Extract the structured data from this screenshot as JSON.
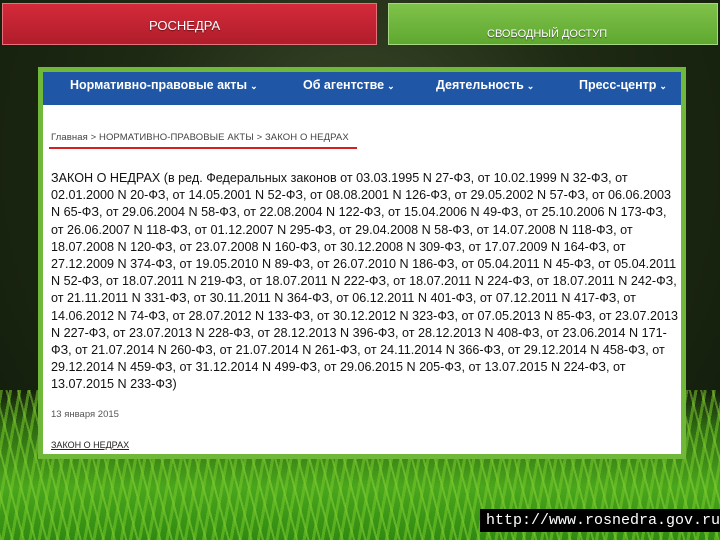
{
  "tabs": {
    "left_label": "РОСНЕДРА",
    "right_label": "СВОБОДНЫЙ ДОСТУП"
  },
  "nav": {
    "items": [
      {
        "label": "Нормативно-правовые акты"
      },
      {
        "label": "Об агентстве"
      },
      {
        "label": "Деятельность"
      },
      {
        "label": "Пресс-центр"
      }
    ],
    "chevron": "⌄"
  },
  "breadcrumb": {
    "text": "Главная > НОРМАТИВНО-ПРАВОВЫЕ АКТЫ > ЗАКОН О НЕДРАХ"
  },
  "law_text": "ЗАКОН О НЕДРАХ (в ред. Федеральных законов от 03.03.1995 N 27-ФЗ, от 10.02.1999 N 32-ФЗ, от 02.01.2000 N 20-ФЗ, от 14.05.2001 N 52-ФЗ, от 08.08.2001 N 126-ФЗ, от 29.05.2002 N 57-ФЗ, от 06.06.2003 N 65-ФЗ, от 29.06.2004 N 58-ФЗ, от 22.08.2004 N 122-ФЗ, от 15.04.2006 N 49-ФЗ, от 25.10.2006 N 173-ФЗ, от 26.06.2007 N 118-ФЗ, от 01.12.2007 N 295-ФЗ, от 29.04.2008 N 58-ФЗ, от 14.07.2008 N 118-ФЗ, от 18.07.2008 N 120-ФЗ, от 23.07.2008 N 160-ФЗ, от 30.12.2008 N 309-ФЗ, от 17.07.2009 N 164-ФЗ, от 27.12.2009 N 374-ФЗ, от 19.05.2010 N 89-ФЗ, от 26.07.2010 N 186-ФЗ, от 05.04.2011 N 45-ФЗ, от 05.04.2011 N 52-ФЗ, от 18.07.2011 N 219-ФЗ, от 18.07.2011 N 222-ФЗ, от 18.07.2011 N 224-ФЗ, от 18.07.2011 N 242-ФЗ, от 21.11.2011 N 331-ФЗ, от 30.11.2011 N 364-ФЗ, от 06.12.2011 N 401-ФЗ, от 07.12.2011 N 417-ФЗ, от 14.06.2012 N 74-ФЗ, от 28.07.2012 N 133-ФЗ, от 30.12.2012 N 323-ФЗ, от 07.05.2013 N 85-ФЗ, от 23.07.2013 N 227-ФЗ, от 23.07.2013 N 228-ФЗ, от 28.12.2013 N 396-ФЗ, от 28.12.2013 N 408-ФЗ, от 23.06.2014 N 171-ФЗ, от 21.07.2014 N 260-ФЗ, от 21.07.2014 N 261-ФЗ, от 24.11.2014 N 366-ФЗ, от 29.12.2014 N 458-ФЗ, от 29.12.2014 N 459-ФЗ, от 31.12.2014 N 499-ФЗ, от 29.06.2015 N 205-ФЗ, от 13.07.2015 N 224-ФЗ, от 13.07.2015 N 233-ФЗ)",
  "date": "13 января 2015",
  "footer_link": "ЗАКОН О НЕДРАХ",
  "url_caption": "http://www.rosnedra.gov.ru/",
  "colors": {
    "nav_bg": "#1f57a6",
    "tab_red": "#c62232",
    "tab_green": "#6fb83a",
    "underline": "#d42020"
  }
}
